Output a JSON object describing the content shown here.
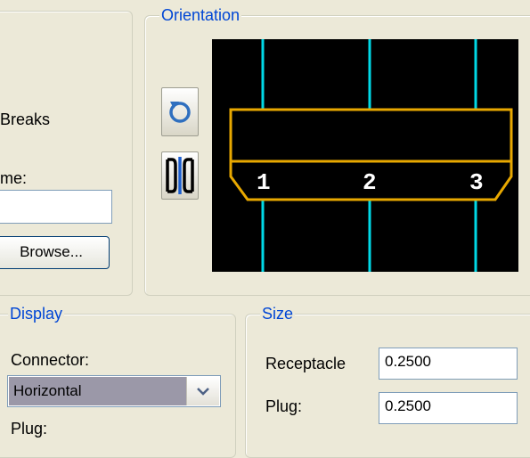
{
  "left_panel": {
    "breaks_label": "Breaks",
    "name_label": "me:",
    "name_value": "",
    "browse_button": "Browse..."
  },
  "orientation": {
    "legend": "Orientation",
    "rotate_icon": "rotate-icon",
    "flip_icon": "flip-icon",
    "pins": [
      "1",
      "2",
      "3"
    ],
    "colors": {
      "background": "#000000",
      "wire": "#00d8e6",
      "outline": "#e8a800",
      "pin_text": "#ffffff"
    }
  },
  "display": {
    "legend": "Display",
    "connector_label": "Connector:",
    "connector_value": "Horizontal",
    "plug_label": "Plug:"
  },
  "size": {
    "legend": "Size",
    "receptacle_label": "Receptacle",
    "receptacle_value": "0.2500",
    "plug_label": "Plug:",
    "plug_value": "0.2500"
  }
}
